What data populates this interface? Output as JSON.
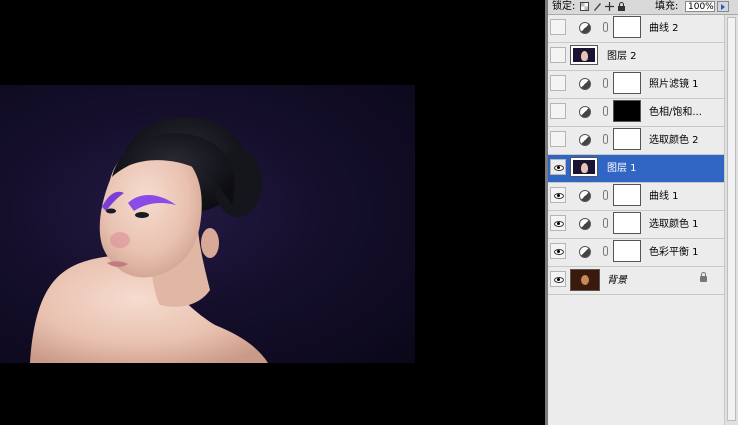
{
  "toolbar": {
    "lock_label": "锁定:",
    "fill_label": "填充:",
    "fill_value": "100%"
  },
  "layers": [
    {
      "name": "曲线 2",
      "kind": "adjustment",
      "visible": false,
      "mask": "white"
    },
    {
      "name": "图层 2",
      "kind": "pixel",
      "visible": false
    },
    {
      "name": "照片滤镜 1",
      "kind": "adjustment",
      "visible": false,
      "mask": "white"
    },
    {
      "name": "色相/饱和...",
      "kind": "adjustment",
      "visible": false,
      "mask": "black"
    },
    {
      "name": "选取颜色 2",
      "kind": "adjustment",
      "visible": false,
      "mask": "white"
    },
    {
      "name": "图层 1",
      "kind": "pixel",
      "visible": true,
      "selected": true
    },
    {
      "name": "曲线 1",
      "kind": "adjustment",
      "visible": true,
      "mask": "white"
    },
    {
      "name": "选取颜色 1",
      "kind": "adjustment",
      "visible": true,
      "mask": "white"
    },
    {
      "name": "色彩平衡 1",
      "kind": "adjustment",
      "visible": true,
      "mask": "white"
    },
    {
      "name": "背景",
      "kind": "background",
      "visible": true,
      "locked": true
    }
  ],
  "colors": {
    "selection": "#3165c3",
    "panel_bg": "#ececec",
    "canvas_bg": "#000000",
    "photo_bg": "#150f2c"
  }
}
